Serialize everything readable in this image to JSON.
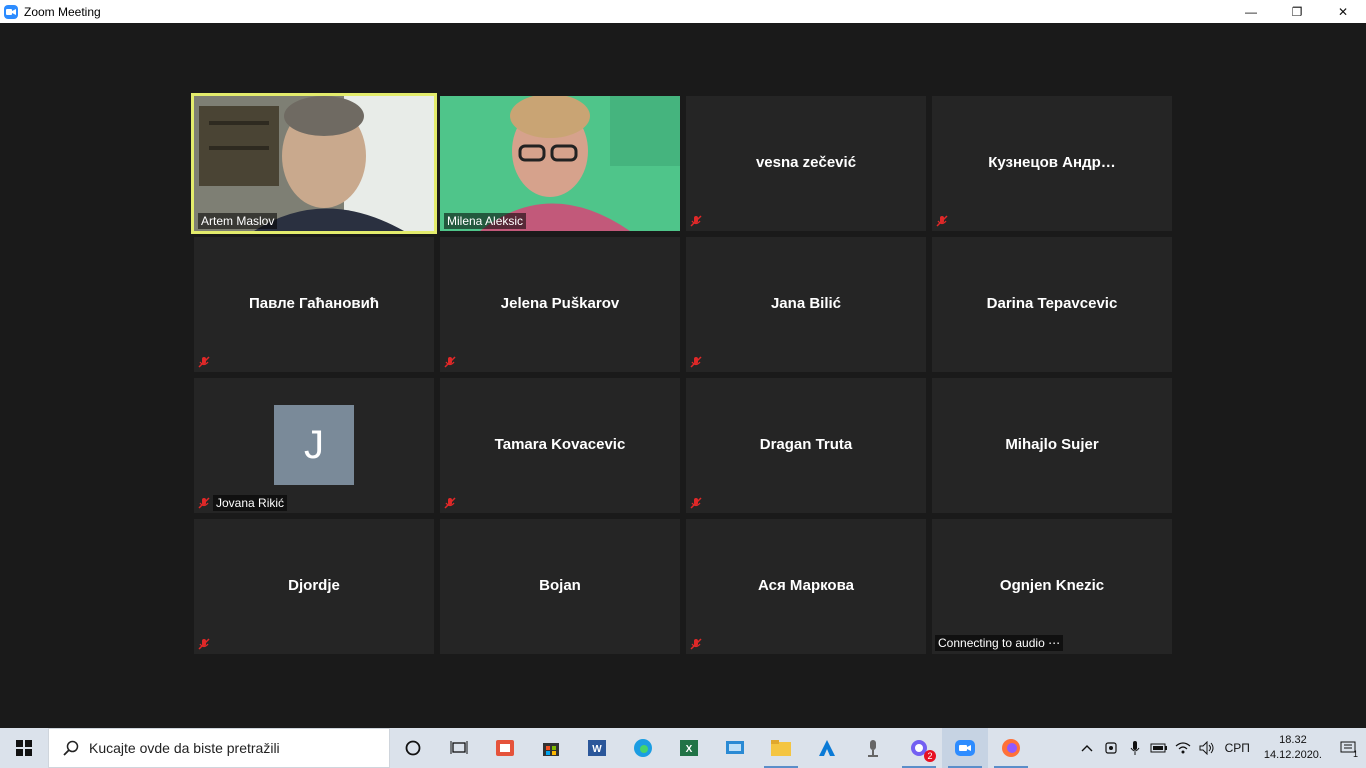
{
  "window": {
    "title": "Zoom Meeting",
    "controls": {
      "minimize": "—",
      "maximize": "❐",
      "close": "✕"
    }
  },
  "gallery": {
    "tiles": [
      {
        "name": "Artem Maslov",
        "video": true,
        "active": true,
        "muted": false
      },
      {
        "name": "Milena Aleksic",
        "video": true,
        "active": false,
        "muted": false
      },
      {
        "name": "vesna zečević",
        "video": false,
        "muted": true
      },
      {
        "name": "Кузнецов  Андр…",
        "video": false,
        "muted": true
      },
      {
        "name": "Павле Гаћановић",
        "video": false,
        "muted": true
      },
      {
        "name": "Jelena Puškarov",
        "video": false,
        "muted": true
      },
      {
        "name": "Jana Bilić",
        "video": false,
        "muted": true
      },
      {
        "name": "Darina Tepavcevic",
        "video": false,
        "muted": false
      },
      {
        "name": "Jovana Rikić",
        "avatar_letter": "J",
        "video": false,
        "muted": true
      },
      {
        "name": "Tamara Kovacevic",
        "video": false,
        "muted": true
      },
      {
        "name": "Dragan Truta",
        "video": false,
        "muted": true
      },
      {
        "name": "Mihajlo Sujer",
        "video": false,
        "muted": false
      },
      {
        "name": "Djordje",
        "video": false,
        "muted": true
      },
      {
        "name": "Bojan",
        "video": false,
        "muted": false
      },
      {
        "name": "Ася Маркова",
        "video": false,
        "muted": true
      },
      {
        "name": "Ognjen Knezic",
        "video": false,
        "muted": false,
        "status": "Connecting to audio ⋯"
      }
    ]
  },
  "taskbar": {
    "search_placeholder": "Kucajte ovde da biste pretražili",
    "apps": [
      "task-view",
      "office",
      "store",
      "word",
      "edge",
      "excel",
      "remote-desktop",
      "file-explorer",
      "app-blue",
      "podcast",
      "viber",
      "zoom",
      "firefox"
    ],
    "viber_badge": "2",
    "tray": {
      "language": "СРП",
      "time": "18.32",
      "date": "14.12.2020.",
      "notifications_badge": "1"
    }
  },
  "colors": {
    "active_speaker_border": "#e3ec6c",
    "tile_bg": "#252525",
    "stage_bg": "#1a1a1a",
    "mute_red": "#e02828"
  }
}
